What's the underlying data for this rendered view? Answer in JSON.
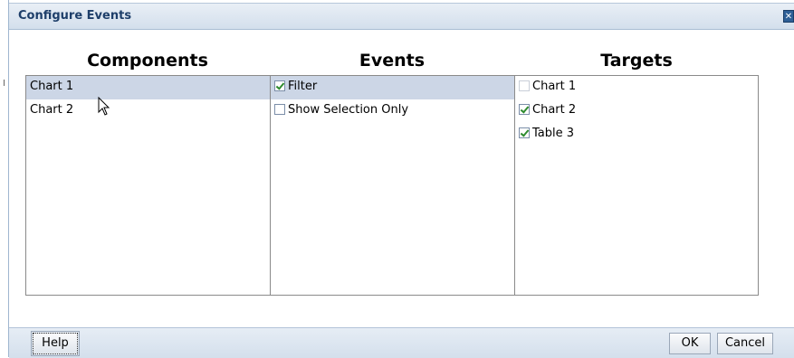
{
  "dialog": {
    "title": "Configure Events",
    "close_icon": "close-icon"
  },
  "columns": {
    "components": {
      "header": "Components",
      "items": [
        {
          "label": "Chart 1",
          "selected": true
        },
        {
          "label": "Chart 2",
          "selected": false
        }
      ]
    },
    "events": {
      "header": "Events",
      "items": [
        {
          "label": "Filter",
          "checked": true,
          "selected": true
        },
        {
          "label": "Show Selection Only",
          "checked": false,
          "selected": false
        }
      ]
    },
    "targets": {
      "header": "Targets",
      "items": [
        {
          "label": "Chart 1",
          "checked": false,
          "disabled": true
        },
        {
          "label": "Chart 2",
          "checked": true,
          "disabled": false
        },
        {
          "label": "Table 3",
          "checked": true,
          "disabled": false
        }
      ]
    }
  },
  "footer": {
    "help_label": "Help",
    "ok_label": "OK",
    "cancel_label": "Cancel"
  },
  "colors": {
    "selection": "#ccd6e6",
    "title_text": "#1e3f6a",
    "check": "#2e8b2e"
  }
}
